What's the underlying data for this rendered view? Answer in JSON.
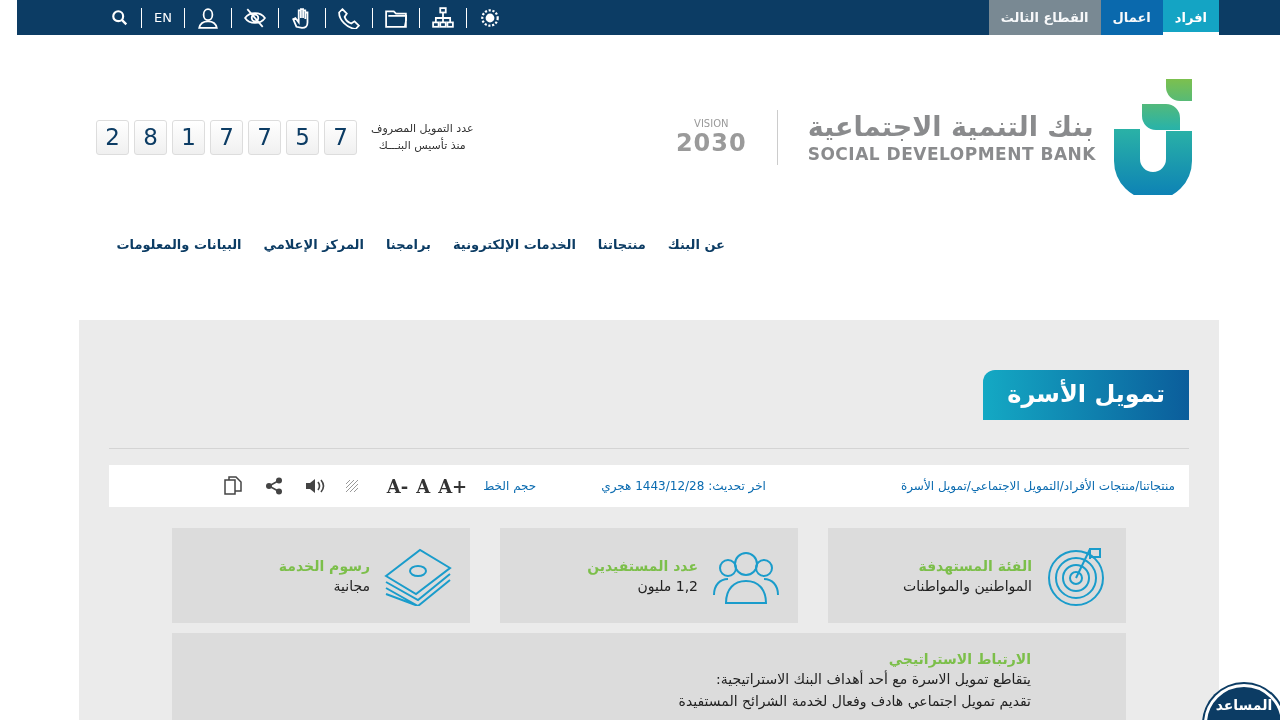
{
  "top_bar": {
    "segments": [
      {
        "label": "افراد",
        "selected": true
      },
      {
        "label": "اعمال",
        "selected": false
      },
      {
        "label": "القطاع الثالث",
        "selected": false
      }
    ],
    "language": "EN"
  },
  "logo": {
    "arabic": "بنك التنمية الاجتماعية",
    "english": "SOCIAL DEVELOPMENT BANK",
    "vision": "VISION",
    "vision_year": "2030"
  },
  "counter": {
    "caption": "عدد التمويل المصروف",
    "subcaption": "منذ تأسيس البنـــك",
    "digits": [
      "7",
      "5",
      "7",
      "7",
      "1",
      "8",
      "2"
    ]
  },
  "nav": [
    "عن البنك",
    "منتجاتنا",
    "الخدمات الإلكترونية",
    "برامجنا",
    "المركز الإعلامي",
    "البيانات والمعلومات"
  ],
  "page_title": "تمويل الأسرة",
  "toolbar": {
    "separator": "/",
    "breadcrumb": [
      "منتجاتنا",
      "منتجات الأفراد",
      "التمويل الاجتماعي",
      "تمويل الأسرة"
    ],
    "updated": "اخر تحديث: 1443/12/28 هجري",
    "font_size_label": "حجم الخط",
    "font_buttons": [
      "A+",
      "A",
      "A-"
    ]
  },
  "cards": [
    {
      "kind": "target",
      "title": "الفئة المستهدفة",
      "value": "المواطنين والمواطنات"
    },
    {
      "kind": "people",
      "title": "عدد المستفيدين",
      "value": "1,2 مليون"
    },
    {
      "kind": "money",
      "title": "رسوم الخدمة",
      "value": "مجانية"
    }
  ],
  "strategy": {
    "title": "الارتباط الاستراتيجي",
    "lines": [
      "يتقاطع تمويل الاسرة مع أحد أهداف البنك الاستراتيجية:",
      "تقديم تمويل اجتماعي هادف وفعال لخدمة الشرائح المستفيدة"
    ]
  },
  "assistant": "المساعد"
}
